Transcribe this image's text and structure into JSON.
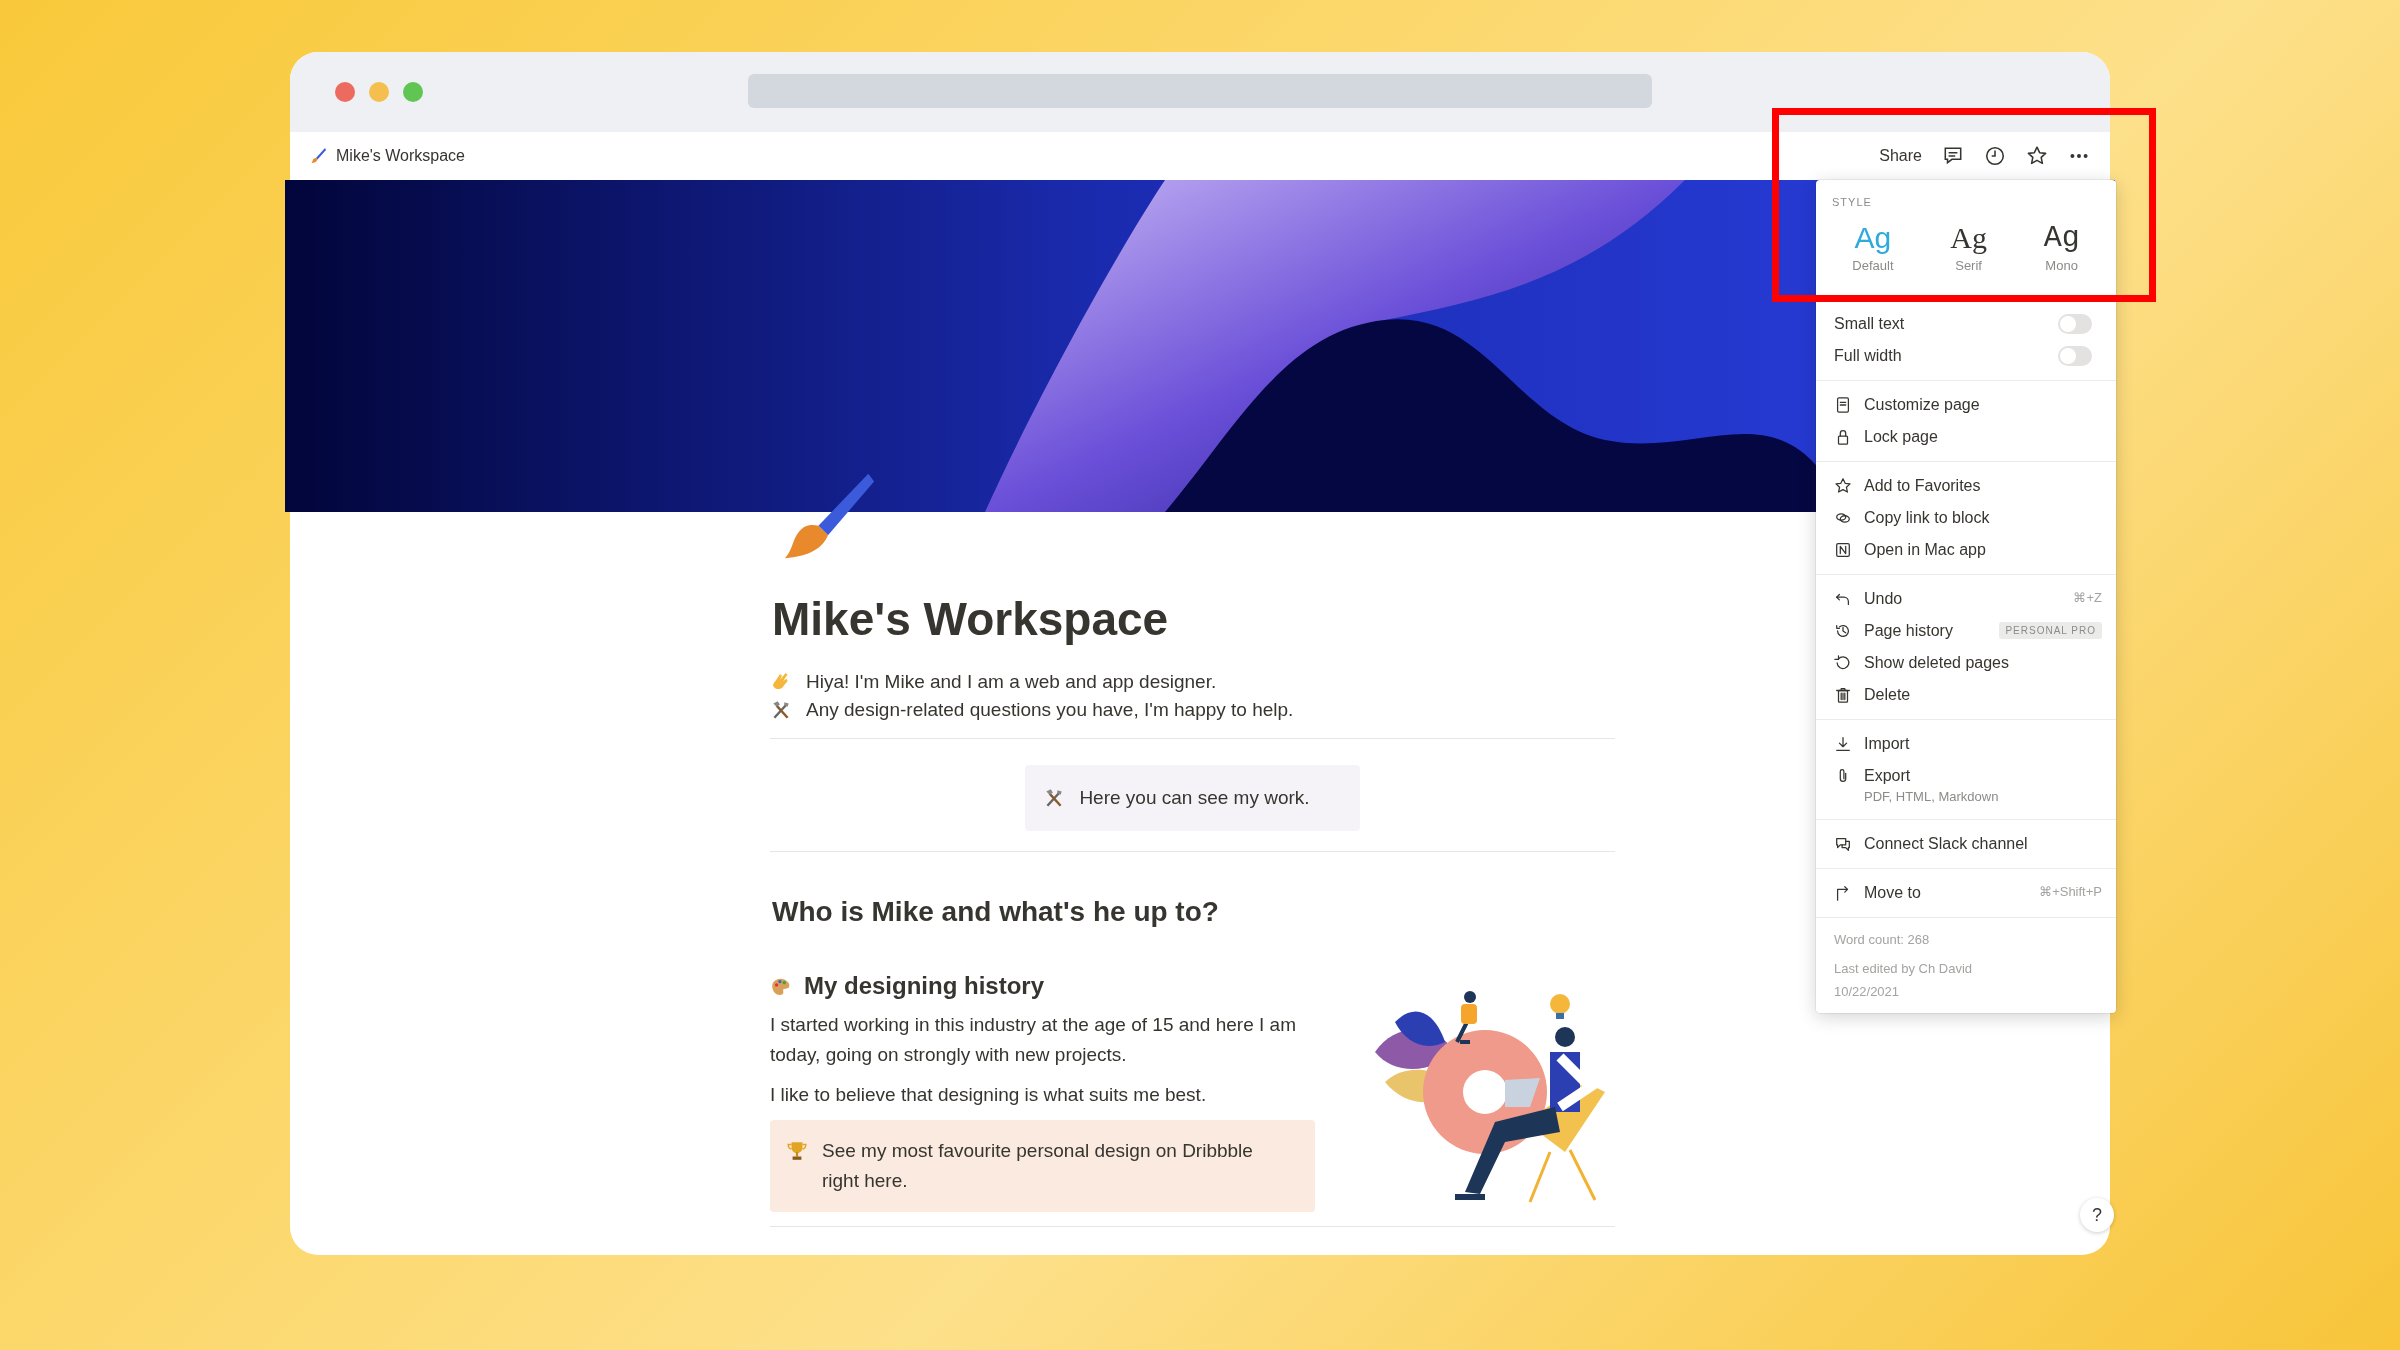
{
  "window": {
    "breadcrumb": "Mike's Workspace"
  },
  "topbar": {
    "share": "Share"
  },
  "page": {
    "title": "Mike's Workspace",
    "intro": [
      {
        "text": "Hiya! I'm Mike and I am a web and app designer."
      },
      {
        "text": "Any design-related questions you have, I'm happy to help."
      }
    ],
    "callout": "Here you can see my work.",
    "heading": "Who is Mike and what's he up to?",
    "subheading": "My designing history",
    "paragraphs": [
      "I started working in this industry at the age of 15 and here I am today, going on strongly with new projects.",
      "I like to believe that designing is what suits me best."
    ],
    "highlight_callout": "See my most favourite personal design on Dribbble right here."
  },
  "menu": {
    "style_label": "STYLE",
    "fonts": [
      {
        "sample": "Ag",
        "label": "Default",
        "selected": true
      },
      {
        "sample": "Ag",
        "label": "Serif",
        "selected": false
      },
      {
        "sample": "Ag",
        "label": "Mono",
        "selected": false
      }
    ],
    "toggles": [
      {
        "label": "Small text",
        "on": false
      },
      {
        "label": "Full width",
        "on": false
      }
    ],
    "groups": [
      {
        "items": [
          {
            "label": "Customize page"
          },
          {
            "label": "Lock page"
          }
        ]
      },
      {
        "items": [
          {
            "label": "Add to Favorites"
          },
          {
            "label": "Copy link to block"
          },
          {
            "label": "Open in Mac app"
          }
        ]
      },
      {
        "items": [
          {
            "label": "Undo",
            "shortcut": "⌘+Z"
          },
          {
            "label": "Page history",
            "badge": "PERSONAL PRO"
          },
          {
            "label": "Show deleted pages"
          },
          {
            "label": "Delete"
          }
        ]
      },
      {
        "items": [
          {
            "label": "Import"
          },
          {
            "label": "Export",
            "subtitle": "PDF, HTML, Markdown"
          }
        ]
      },
      {
        "items": [
          {
            "label": "Connect Slack channel"
          }
        ]
      },
      {
        "items": [
          {
            "label": "Move to",
            "shortcut": "⌘+Shift+P"
          }
        ]
      }
    ],
    "footer": {
      "word_count": "Word count: 268",
      "last_edited": "Last edited by Ch David",
      "date": "10/22/2021"
    }
  },
  "help": "?"
}
